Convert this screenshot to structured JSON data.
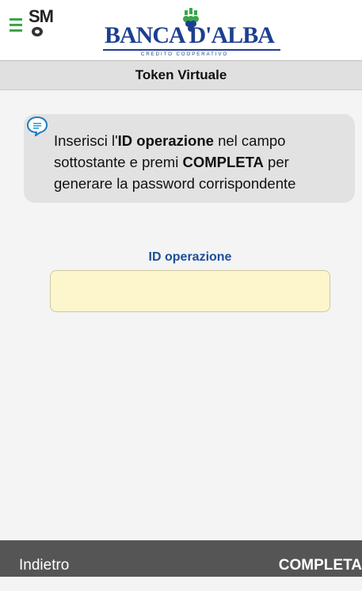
{
  "header": {
    "sm_logo": "SM",
    "bank_name": "BANCA D'ALBA",
    "bank_subtitle": "CREDITO COOPERATIVO",
    "brand_color": "#1d3f8f",
    "menu_icon": "hamburger-menu-icon"
  },
  "titlebar": {
    "title": "Token Virtuale"
  },
  "instructions": {
    "icon": "chat-bubble-icon",
    "text_before_id": "Inserisci l'",
    "id_bold": "ID operazione",
    "text_mid": " nel campo sottostante e premi ",
    "complete_bold": "COMPLETA",
    "text_after": " per generare la password corrispondente"
  },
  "form": {
    "label": "ID operazione",
    "value": "",
    "field_bg": "#fdf6cc"
  },
  "bottombar": {
    "back_label": "Indietro",
    "complete_label": "COMPLETA"
  }
}
